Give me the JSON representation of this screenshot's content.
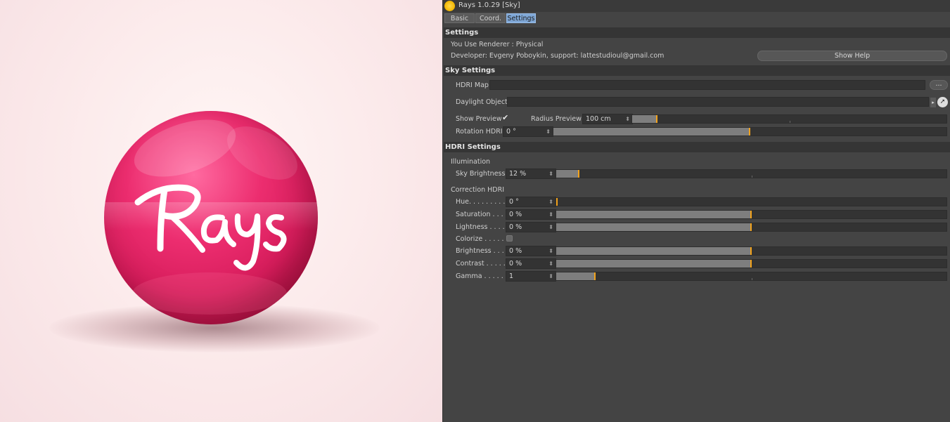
{
  "render": {
    "logo_text": "Rays",
    "ball_color": "#e0226a",
    "background_color": "#fdf0f0"
  },
  "panel": {
    "title": "Rays 1.0.29 [Sky]",
    "tabs": [
      {
        "label": "Basic",
        "active": false
      },
      {
        "label": "Coord.",
        "active": false
      },
      {
        "label": "Settings",
        "active": true
      }
    ],
    "settings": {
      "header": "Settings",
      "renderer_text": "You Use Renderer : Physical",
      "developer_text": "Developer: Evgeny Poboykin, support: lattestudioul@gmail.com",
      "show_help_label": "Show Help"
    },
    "sky": {
      "header": "Sky Settings",
      "hdri_map_label": "HDRI Map",
      "hdri_map_value": "",
      "browse_label": "...",
      "daylight_label": "Daylight Object",
      "daylight_value": "",
      "show_preview_label": "Show Preview",
      "show_preview_checked": true,
      "radius_label": "Radius Preview",
      "radius_value": "100 cm",
      "radius_fraction": 0.08,
      "rotation_label": "Rotation HDRI",
      "rotation_value": "0 °",
      "rotation_fraction": 0.5
    },
    "hdri": {
      "header": "HDRI Settings",
      "illumination_label": "Illumination",
      "sky_brightness_label": "Sky Brightness",
      "sky_brightness_value": "12 %",
      "sky_brightness_fraction": 0.06,
      "correction_label": "Correction HDRI",
      "hue_label": "Hue. . . . . . . . . .",
      "hue_value": "0 °",
      "hue_fraction": 0.0,
      "saturation_label": "Saturation . . . .",
      "saturation_value": "0 %",
      "saturation_fraction": 0.5,
      "lightness_label": "Lightness . . . . .",
      "lightness_value": "0 %",
      "lightness_fraction": 0.5,
      "colorize_label": "Colorize . . . . . .",
      "colorize_checked": false,
      "brightness_label": "Brightness . . . .",
      "brightness_value": "0 %",
      "brightness_fraction": 0.5,
      "contrast_label": "Contrast . . . . . .",
      "contrast_value": "0 %",
      "contrast_fraction": 0.5,
      "gamma_label": "Gamma . . . . . .",
      "gamma_value": "1",
      "gamma_fraction": 0.1
    },
    "colors": {
      "panel_bg": "#444444",
      "section_bg": "#353535",
      "slider_fill": "#7e7e7e",
      "slider_marker": "#f2a21a",
      "active_tab": "#7fa7d6"
    }
  }
}
